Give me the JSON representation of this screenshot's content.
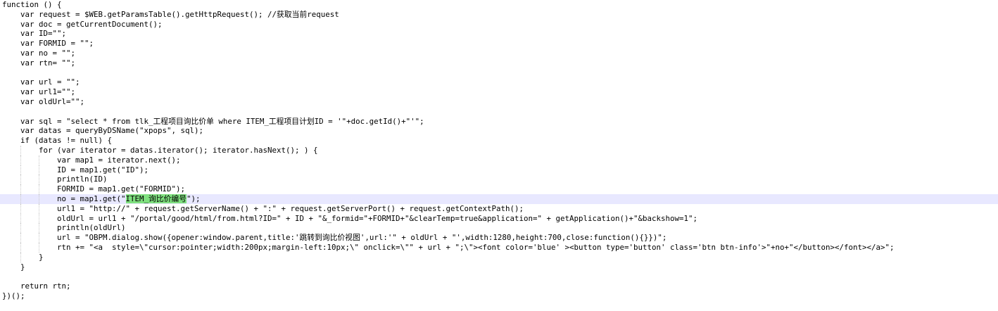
{
  "editor": {
    "highlight_color": "#7fe07f",
    "current_line_color": "#e8e8ff",
    "lines": [
      "function () {",
      "    var request = $WEB.getParamsTable().getHttpRequest(); //获取当前request",
      "    var doc = getCurrentDocument();",
      "    var ID=\"\";",
      "    var FORMID = \"\";",
      "    var no = \"\";",
      "    var rtn= \"\";",
      "",
      "    var url = \"\";",
      "    var url1=\"\";",
      "    var oldUrl=\"\";",
      "",
      "    var sql = \"select * from tlk_工程项目询比价单 where ITEM_工程项目计划ID = '\"+doc.getId()+\"'\";",
      "    var datas = queryByDSName(\"xpops\", sql);",
      "    if (datas != null) {",
      "        for (var iterator = datas.iterator(); iterator.hasNext(); ) {",
      "            var map1 = iterator.next();",
      "            ID = map1.get(\"ID\");",
      "            println(ID)",
      "            FORMID = map1.get(\"FORMID\");",
      "            no = map1.get(\"ITEM_询比价编号\");",
      "            url1 = \"http://\" + request.getServerName() + \":\" + request.getServerPort() + request.getContextPath();",
      "            oldUrl = url1 + \"/portal/good/html/from.html?ID=\" + ID + \"&_formid=\"+FORMID+\"&clearTemp=true&application=\" + getApplication()+\"&backshow=1\";",
      "            println(oldUrl)",
      "            url = \"OBPM.dialog.show({opener:window.parent,title:'跳转到询比价视图',url:'\" + oldUrl + \"',width:1280,height:700,close:function(){}})\";",
      "            rtn += \"<a  style=\\\"cursor:pointer;width:200px;margin-left:10px;\\\" onclick=\\\"\" + url + \";\\\"><font color='blue' ><button type='button' class='btn btn-info'>\"+no+\"</button></font></a>\";",
      "        }",
      "    }",
      "",
      "    return rtn;",
      "})();"
    ],
    "highlighted_token": "ITEM_询比价编号"
  }
}
